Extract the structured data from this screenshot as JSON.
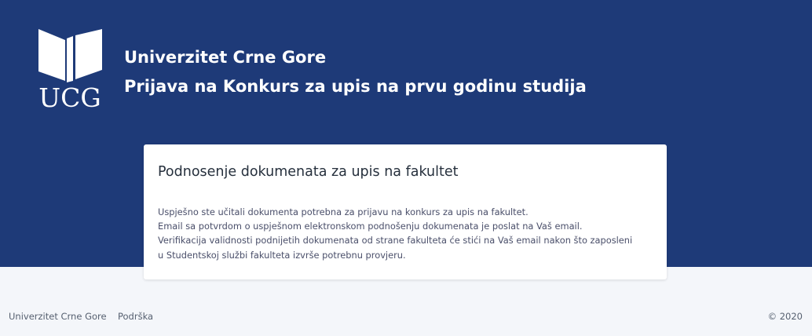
{
  "header": {
    "logo_text": "UCG",
    "logo_icon": "open-book-icon",
    "title": "Univerzitet Crne Gore",
    "subtitle": "Prijava na Konkurs za upis na prvu godinu studija",
    "background_color": "#1e3a78"
  },
  "card": {
    "title": "Podnosenje dokumenata za upis na fakultet",
    "lines": [
      "Uspješno ste učitali dokumenta potrebna za prijavu na konkurs za upis na fakultet.",
      "Email sa potvrdom o uspješnom elektronskom podnošenju dokumenata je poslat na Vaš email.",
      "Verifikacija validnosti podnijetih dokumenata od strane fakulteta će stići na Vaš email nakon što zaposleni",
      "u Studentskoj službi fakulteta izvrše potrebnu provjeru."
    ]
  },
  "footer": {
    "home_link": "Univerzitet Crne Gore",
    "support_link": "Podrška",
    "copyright": "© 2020"
  }
}
